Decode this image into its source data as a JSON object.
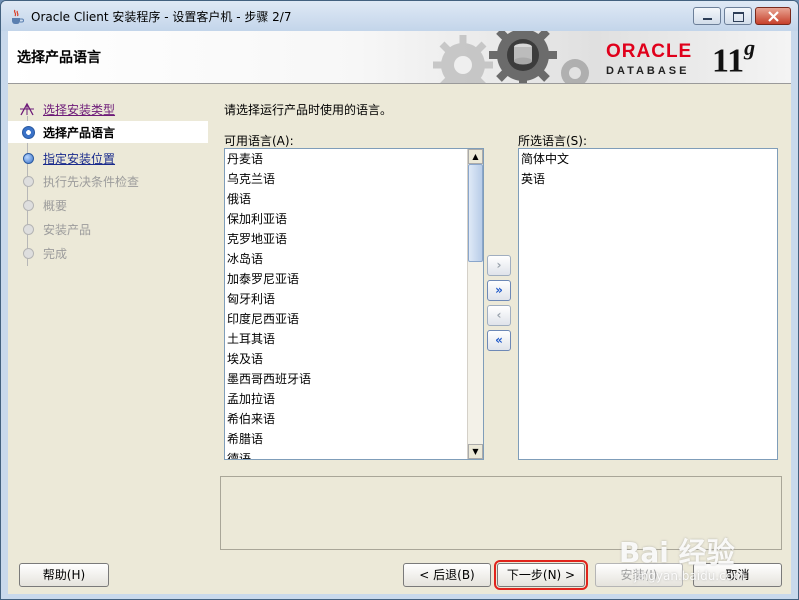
{
  "window": {
    "title": "Oracle Client 安装程序 - 设置客户机 - 步骤 2/7"
  },
  "header": {
    "page_title": "选择产品语言",
    "brand": "ORACLE",
    "product": "DATABASE",
    "version": "11",
    "version_suffix": "g"
  },
  "steps": [
    {
      "label": "选择安装类型",
      "state": "done"
    },
    {
      "label": "选择产品语言",
      "state": "current"
    },
    {
      "label": "指定安装位置",
      "state": "link"
    },
    {
      "label": "执行先决条件检查",
      "state": "future"
    },
    {
      "label": "概要",
      "state": "future"
    },
    {
      "label": "安装产品",
      "state": "future"
    },
    {
      "label": "完成",
      "state": "future"
    }
  ],
  "main": {
    "instruction": "请选择运行产品时使用的语言。",
    "available_label": "可用语言(A):",
    "selected_label": "所选语言(S):",
    "available_languages": [
      "丹麦语",
      "乌克兰语",
      "俄语",
      "保加利亚语",
      "克罗地亚语",
      "冰岛语",
      "加泰罗尼亚语",
      "匈牙利语",
      "印度尼西亚语",
      "土耳其语",
      "埃及语",
      "墨西哥西班牙语",
      "孟加拉语",
      "希伯来语",
      "希腊语",
      "德语"
    ],
    "selected_languages": [
      "简体中文",
      "英语"
    ],
    "move_buttons": [
      {
        "symbol": "›",
        "enabled": false
      },
      {
        "symbol": "»",
        "enabled": true
      },
      {
        "symbol": "‹",
        "enabled": false
      },
      {
        "symbol": "«",
        "enabled": true
      }
    ]
  },
  "footer": {
    "help_label": "帮助(H)",
    "back_label": "< 后退(B)",
    "next_label": "下一步(N) >",
    "install_label": "安装(I)",
    "cancel_label": "取消"
  },
  "watermark": {
    "text": "Bai 经验",
    "url": "jingyan.baidu.com"
  },
  "colors": {
    "brand_red": "#e0001b",
    "accent_blue": "#3a72c8",
    "focus_outline": "#e1241c"
  }
}
